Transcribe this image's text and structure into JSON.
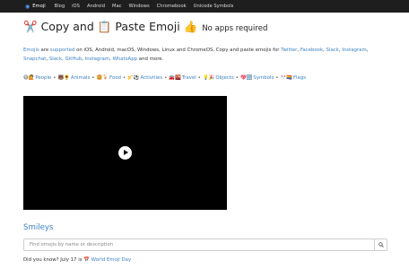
{
  "nav": {
    "brand": "Emoji",
    "brand_icon": "globe-icon",
    "links": [
      "Blog",
      "iOS",
      "Android",
      "Mac",
      "Windows",
      "Chromebook",
      "Unicode Symbols"
    ]
  },
  "header": {
    "scissors": "✂️",
    "title_a": "Copy and",
    "clipboard": "📋",
    "title_b": "Paste Emoji",
    "thumb": "👍",
    "subtitle": "No apps required"
  },
  "intro": {
    "emojis": "Emojis",
    "are": "are",
    "supported": "supported",
    "platforms": "on iOS, Android, macOS, Windows, Linux and ChromeOS. Copy and paste emojis for",
    "twitter": "Twitter",
    "facebook": "Facebook",
    "slack": "Slack",
    "instagram": "Instagram",
    "snapchat": "Snapchat",
    "slack2": "Slack",
    "github": "GitHub",
    "instagram2": "Instagram",
    "whatsapp": "WhatsApp",
    "more": "and more."
  },
  "categories": [
    {
      "emoji": "😄🙋",
      "label": "People"
    },
    {
      "emoji": "🐻🌻",
      "label": "Animals"
    },
    {
      "emoji": "🍔🍹",
      "label": "Food"
    },
    {
      "emoji": "🎷⚽️",
      "label": "Activities"
    },
    {
      "emoji": "🚘🌇",
      "label": "Travel"
    },
    {
      "emoji": "💡🎉",
      "label": "Objects"
    },
    {
      "emoji": "💖🔣",
      "label": "Symbols"
    },
    {
      "emoji": "🎌🏳️‍🌈",
      "label": "Flags"
    }
  ],
  "video": {
    "play_icon": "play-icon"
  },
  "section": {
    "heading": "Smileys"
  },
  "search": {
    "placeholder": "Find emojis by name or description",
    "icon": "search-icon"
  },
  "did_you_know": {
    "prefix": "Did you know? July 17 is",
    "emoji": "📅",
    "link": "World Emoji Day"
  }
}
